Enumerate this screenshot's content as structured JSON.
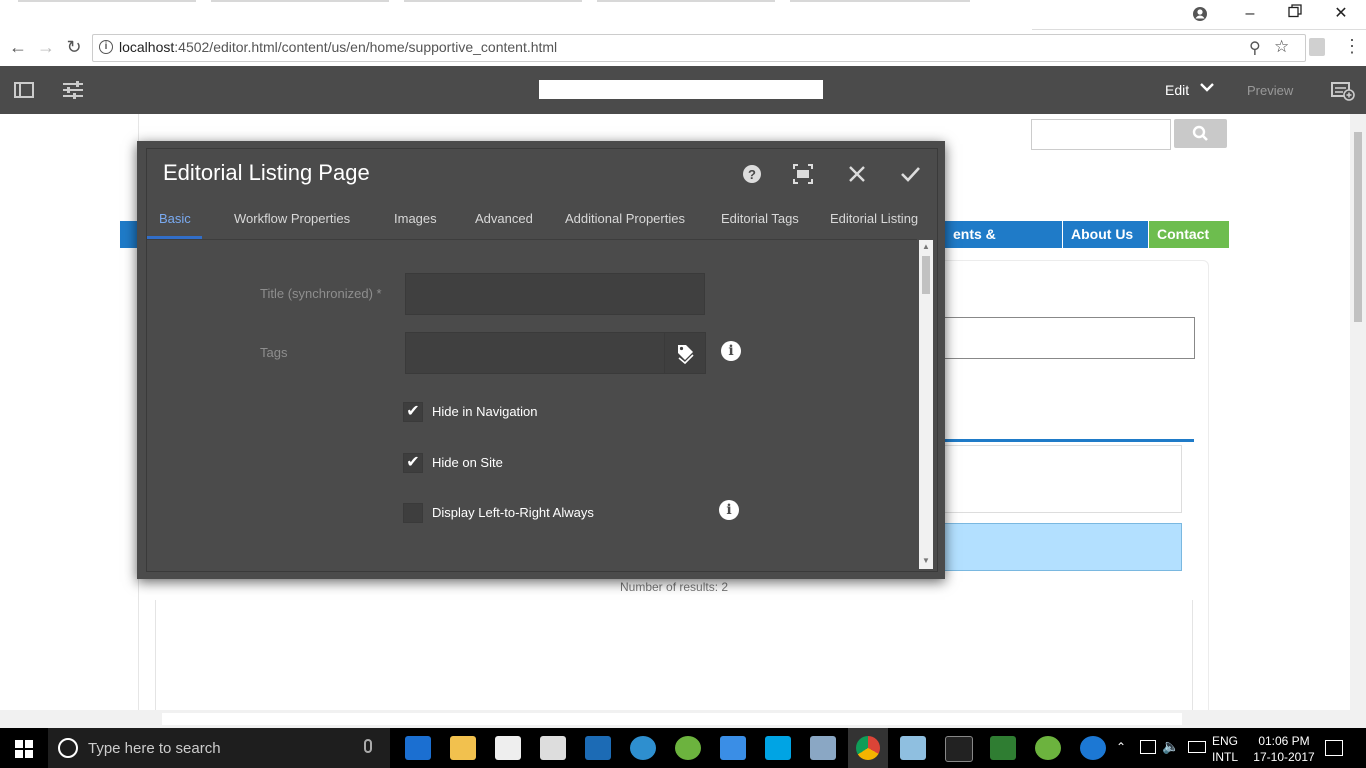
{
  "browser": {
    "url_prefix": "localhost",
    "url_rest": ":4502/editor.html/content/us/en/home/supportive_content.html"
  },
  "aem_bar": {
    "mode_label": "Edit",
    "preview_label": "Preview"
  },
  "page_behind": {
    "nav_items": [
      "ents & Expertise",
      "About Us",
      "Contact Us"
    ],
    "results_text": "Number of results: 2",
    "colors": {
      "nav_blue": "#1f7bc8",
      "contact_green": "#6dbd4e",
      "highlight_row": "#b3e0ff"
    }
  },
  "dialog": {
    "title": "Editorial Listing Page",
    "tabs": [
      "Basic",
      "Workflow Properties",
      "Images",
      "Advanced",
      "Additional Properties",
      "Editorial Tags",
      "Editorial Listing"
    ],
    "active_tab": "Basic",
    "fields": {
      "title_label": "Title (synchronized) *",
      "title_value": "",
      "tags_label": "Tags",
      "tags_value": ""
    },
    "checkboxes": [
      {
        "label": "Hide in Navigation",
        "checked": true
      },
      {
        "label": "Hide on Site",
        "checked": true
      },
      {
        "label": "Display Left-to-Right Always",
        "checked": false
      }
    ],
    "colors": {
      "background": "#4b4b4b",
      "accent": "#326ec8"
    }
  },
  "taskbar": {
    "search_placeholder": "Type here to search",
    "language_top": "ENG",
    "language_bottom": "INTL",
    "time": "01:06 PM",
    "date": "17-10-2017"
  }
}
